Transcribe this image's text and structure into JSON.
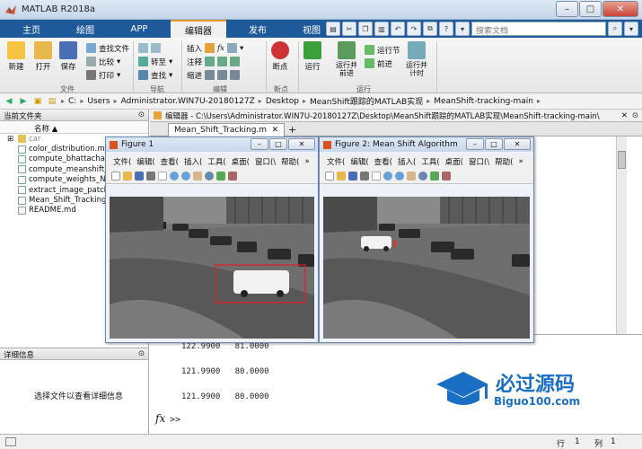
{
  "window": {
    "title": "MATLAB R2018a"
  },
  "tabs": [
    {
      "label": "主页"
    },
    {
      "label": "绘图"
    },
    {
      "label": "APP"
    },
    {
      "label": "编辑器"
    },
    {
      "label": "发布"
    },
    {
      "label": "视图"
    }
  ],
  "search": {
    "placeholder": "搜索文档"
  },
  "ribbon": {
    "new": "新建",
    "open": "打开",
    "save": "保存",
    "find_files": "查找文件",
    "compare": "比较",
    "print": "打印",
    "file_group": "文件",
    "goto": "转至",
    "find": "查找",
    "nav_group": "导航",
    "insert": "插入",
    "comment": "注释",
    "indent": "缩进",
    "edit_group": "编辑",
    "breakpoints": "断点",
    "bp_group": "断点",
    "run": "运行",
    "run_advance": "运行并前进",
    "advance": "前进",
    "run_section": "运行节",
    "run_time": "运行并计时",
    "run_group": "运行"
  },
  "address": {
    "drive": "C:",
    "crumbs": [
      "Users",
      "Administrator.WIN7U-20180127Z",
      "Desktop",
      "MeanShift跟踪的MATLAB实现",
      "MeanShift-tracking-main"
    ]
  },
  "left_panel": {
    "title": "当前文件夹",
    "col_name": "名称",
    "sort_arrow": "▲",
    "files": [
      {
        "name": "car"
      },
      {
        "name": "color_distribution.m"
      },
      {
        "name": "compute_bhattacharyya"
      },
      {
        "name": "compute_meanshift_v"
      },
      {
        "name": "compute_weights_NG"
      },
      {
        "name": "extract_image_patch"
      },
      {
        "name": "Mean_Shift_Tracking"
      },
      {
        "name": "README.md"
      }
    ]
  },
  "details": {
    "title": "详细信息",
    "text": "选择文件以查看详细信息"
  },
  "editor": {
    "path_label": "编辑器 - C:\\Users\\Administrator.WIN7U-20180127Z\\Desktop\\MeanShift跟踪的MATLAB实现\\MeanShift-tracking-main\\",
    "tab": "Mean_Shift_Tracking.m",
    "add_tab": "+"
  },
  "console": {
    "rows": [
      "122.9900   81.0000",
      "121.9900   80.0000",
      "121.9900   80.0000"
    ],
    "prompt": "fx",
    "prompt_symbol": ">>"
  },
  "status": {
    "line_label": "行",
    "line": "1",
    "col_label": "列",
    "col": "1"
  },
  "figure1": {
    "title": "Figure 1",
    "menu": [
      "文件(",
      "编辑(",
      "查看(",
      "插入(",
      "工具(",
      "桌面(",
      "窗口(\\",
      "帮助("
    ],
    "more": "»"
  },
  "figure2": {
    "title": "Figure 2: Mean Shift Algorithm",
    "menu": [
      "文件(",
      "编辑(",
      "查看(",
      "插入(",
      "工具(",
      "桌面(",
      "窗口(\\",
      "帮助("
    ],
    "more": "»"
  },
  "watermark": {
    "brand": "必过源码",
    "url": "Biguo100.com"
  },
  "colors": {
    "accent_tab": "#1e5a99",
    "tracking_box": "#e02020"
  }
}
